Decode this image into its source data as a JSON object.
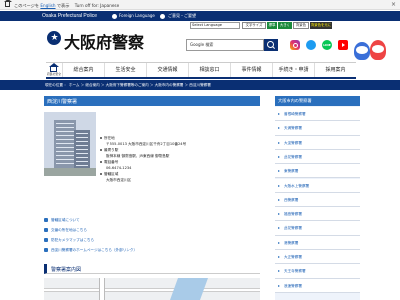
{
  "translate_bar": {
    "text_prefix": "このページを",
    "lang_link": "English",
    "text_suffix": "で表示",
    "off_text": "Turn off for: Japanese",
    "close": "×"
  },
  "header": {
    "org_name": "Osaka Prefectural Police",
    "foreign_language": "Foreign Language",
    "contact": "ご意見・ご要望"
  },
  "site_title": "大阪府警察",
  "tools": {
    "select_language": "Select Language",
    "text_size_label": "文字サイズ",
    "text_std": "標準",
    "text_big": "大きく",
    "bg_label": "背景色",
    "bg_option": "背景色を元に"
  },
  "search": {
    "placeholder": "Google 検索"
  },
  "sns": {
    "line": "LINE"
  },
  "nav": {
    "home_label": "府民の安全",
    "items": [
      "総合案内",
      "生活安全",
      "交通情報",
      "相談窓口",
      "事件情報",
      "手続き・申請",
      "採用案内"
    ]
  },
  "breadcrumb": "現在の位置 ： ホーム ＞ 総合案内 ＞ 大阪府下警察署等のご案内 ＞ 大阪市内の警察署 ＞ 西淀川警察署",
  "page_title": "西淀川警察署",
  "info": {
    "address_label": "所在地",
    "address": "〒555-0013 大阪市西淀川区千舟2丁目10番24号",
    "access_label": "最寄り駅",
    "access": "阪神本線 御幣島駅、JR東西線 御幣島駅",
    "phone_label": "電話番号",
    "phone": "06-6474-1234",
    "area_label": "管轄区域",
    "area": "大阪市西淀川区"
  },
  "links": [
    "管轄区域について",
    "交番の所在地はこちら",
    "防犯カメラマップはこちら",
    "西淀川警察署のホームページはこちら（外部リンク）"
  ],
  "section_heading": "警察署案内図",
  "sidebar": {
    "heading": "大阪市内の警察署",
    "items": [
      "曽根崎警察署",
      "天満警察署",
      "大淀警察署",
      "此花警察署",
      "東警察署",
      "大阪水上警察署",
      "西警察署",
      "福島警察署",
      "此花警察署",
      "港警察署",
      "大正警察署",
      "天王寺警察署",
      "浪速警察署"
    ]
  }
}
